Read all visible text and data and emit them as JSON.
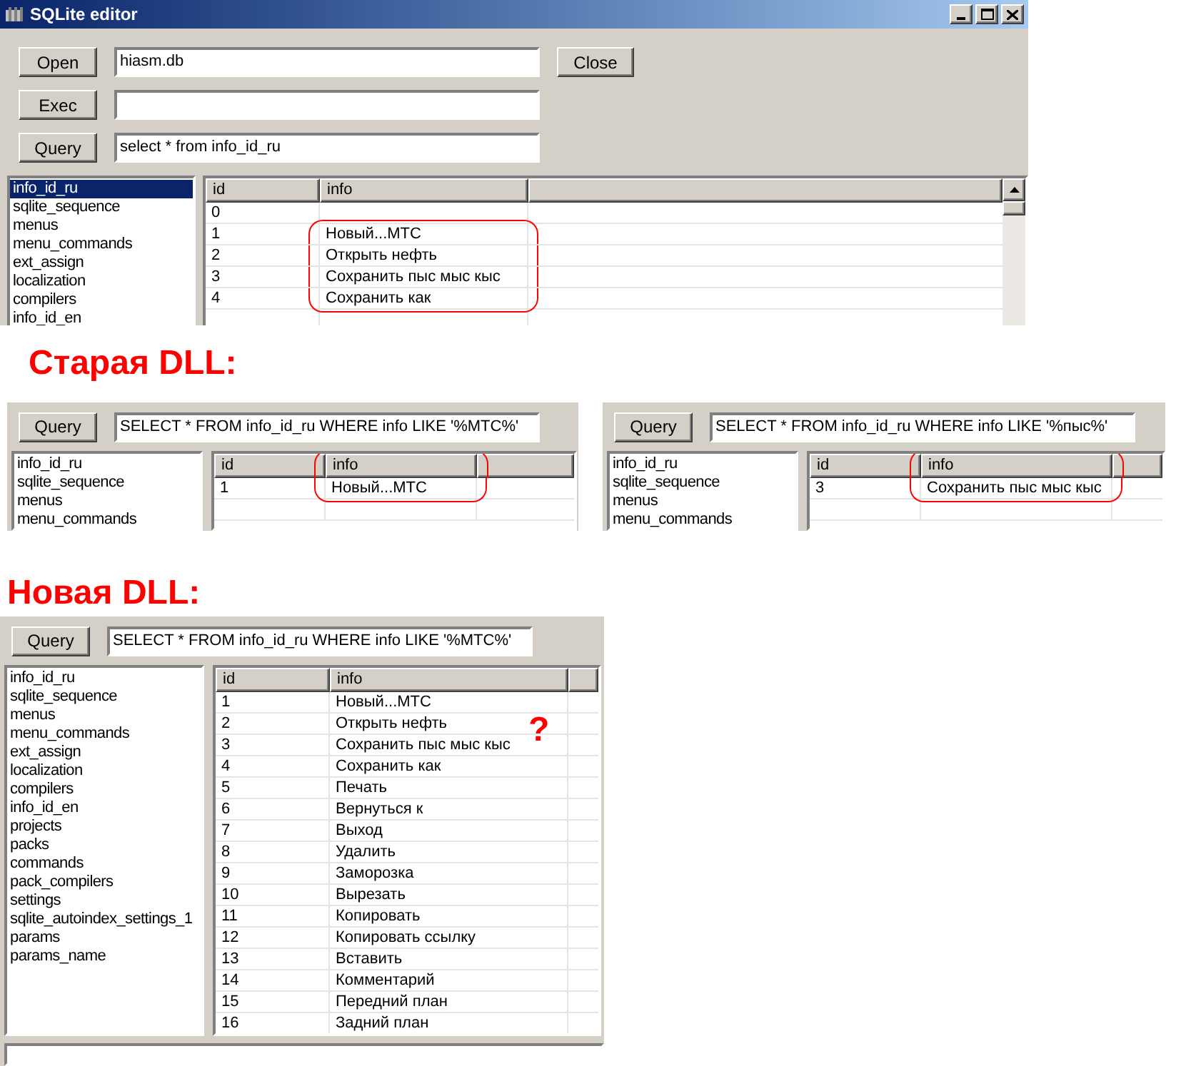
{
  "window": {
    "title": "SQLite editor",
    "controls": [
      {
        "button": "Open",
        "value": "hiasm.db",
        "extra_button": "Close"
      },
      {
        "button": "Exec"
      },
      {
        "button": "Query",
        "value": "select * from info_id_ru"
      }
    ],
    "tables": [
      {
        "name": "info_id_ru",
        "selected": true
      },
      {
        "name": "sqlite_sequence",
        "selected": false
      },
      {
        "name": "menus",
        "selected": false
      },
      {
        "name": "menu_commands",
        "selected": false
      },
      {
        "name": "ext_assign",
        "selected": false
      },
      {
        "name": "localization",
        "selected": false
      },
      {
        "name": "compilers",
        "selected": false
      },
      {
        "name": "info_id_en",
        "selected": false
      }
    ],
    "grid": {
      "columns": [
        {
          "label": "id",
          "circled": false
        },
        {
          "label": "info",
          "circled": false
        }
      ],
      "rows": [
        {
          "cells": [
            "0",
            ""
          ],
          "circled": false
        },
        {
          "cells": [
            "1",
            "Новый...МТС"
          ],
          "circled": true
        },
        {
          "cells": [
            "2",
            "Открыть нефть"
          ],
          "circled": true
        },
        {
          "cells": [
            "3",
            "Сохранить пыс мыс кыс"
          ],
          "circled": true
        },
        {
          "cells": [
            "4",
            "Сохранить как"
          ],
          "circled": true
        }
      ]
    }
  },
  "sections": [
    {
      "heading": "Старая DLL:",
      "panels": [
        {
          "query_button": "Query",
          "query": "SELECT * FROM info_id_ru WHERE info LIKE '%MTC%'",
          "tables": [
            {
              "name": "info_id_ru",
              "selected": false
            },
            {
              "name": "sqlite_sequence",
              "selected": false
            },
            {
              "name": "menus",
              "selected": false
            },
            {
              "name": "menu_commands",
              "selected": false
            }
          ],
          "grid": {
            "columns": [
              {
                "label": "id",
                "circled": false
              },
              {
                "label": "info",
                "circled": true
              }
            ],
            "rows": [
              {
                "cells": [
                  "1",
                  "Новый...МТС"
                ],
                "circled": true
              }
            ]
          }
        },
        {
          "query_button": "Query",
          "query": "SELECT * FROM info_id_ru WHERE info LIKE '%пыс%'",
          "tables": [
            {
              "name": "info_id_ru",
              "selected": false
            },
            {
              "name": "sqlite_sequence",
              "selected": false
            },
            {
              "name": "menus",
              "selected": false
            },
            {
              "name": "menu_commands",
              "selected": false
            }
          ],
          "grid": {
            "columns": [
              {
                "label": "id",
                "circled": false
              },
              {
                "label": "info",
                "circled": true
              }
            ],
            "rows": [
              {
                "cells": [
                  "3",
                  "Сохранить пыс мыс кыс"
                ],
                "circled": true
              }
            ]
          }
        }
      ]
    },
    {
      "heading": "Новая DLL:",
      "note": "?",
      "panels": [
        {
          "query_button": "Query",
          "query": "SELECT * FROM info_id_ru WHERE info LIKE '%MTC%'",
          "tables": [
            {
              "name": "info_id_ru",
              "selected": false
            },
            {
              "name": "sqlite_sequence",
              "selected": false
            },
            {
              "name": "menus",
              "selected": false
            },
            {
              "name": "menu_commands",
              "selected": false
            },
            {
              "name": "ext_assign",
              "selected": false
            },
            {
              "name": "localization",
              "selected": false
            },
            {
              "name": "compilers",
              "selected": false
            },
            {
              "name": "info_id_en",
              "selected": false
            },
            {
              "name": "projects",
              "selected": false
            },
            {
              "name": "packs",
              "selected": false
            },
            {
              "name": "commands",
              "selected": false
            },
            {
              "name": "pack_compilers",
              "selected": false
            },
            {
              "name": "settings",
              "selected": false
            },
            {
              "name": "sqlite_autoindex_settings_1",
              "selected": false
            },
            {
              "name": "params",
              "selected": false
            },
            {
              "name": "params_name",
              "selected": false
            }
          ],
          "grid": {
            "columns": [
              {
                "label": "id",
                "circled": false
              },
              {
                "label": "info",
                "circled": false
              }
            ],
            "rows": [
              {
                "cells": [
                  "1",
                  "Новый...МТС"
                ],
                "circled": false
              },
              {
                "cells": [
                  "2",
                  "Открыть нефть"
                ],
                "circled": false
              },
              {
                "cells": [
                  "3",
                  "Сохранить пыс мыс кыс"
                ],
                "circled": false
              },
              {
                "cells": [
                  "4",
                  "Сохранить как"
                ],
                "circled": false
              },
              {
                "cells": [
                  "5",
                  "Печать"
                ],
                "circled": false
              },
              {
                "cells": [
                  "6",
                  "Вернуться к"
                ],
                "circled": false
              },
              {
                "cells": [
                  "7",
                  "Выход"
                ],
                "circled": false
              },
              {
                "cells": [
                  "8",
                  "Удалить"
                ],
                "circled": false
              },
              {
                "cells": [
                  "9",
                  "Заморозка"
                ],
                "circled": false
              },
              {
                "cells": [
                  "10",
                  "Вырезать"
                ],
                "circled": false
              },
              {
                "cells": [
                  "11",
                  "Копировать"
                ],
                "circled": false
              },
              {
                "cells": [
                  "12",
                  "Копировать ссылку"
                ],
                "circled": false
              },
              {
                "cells": [
                  "13",
                  "Вставить"
                ],
                "circled": false
              },
              {
                "cells": [
                  "14",
                  "Комментарий"
                ],
                "circled": false
              },
              {
                "cells": [
                  "15",
                  "Передний план"
                ],
                "circled": false
              },
              {
                "cells": [
                  "16",
                  "Задний план"
                ],
                "circled": false
              }
            ]
          }
        }
      ]
    }
  ]
}
